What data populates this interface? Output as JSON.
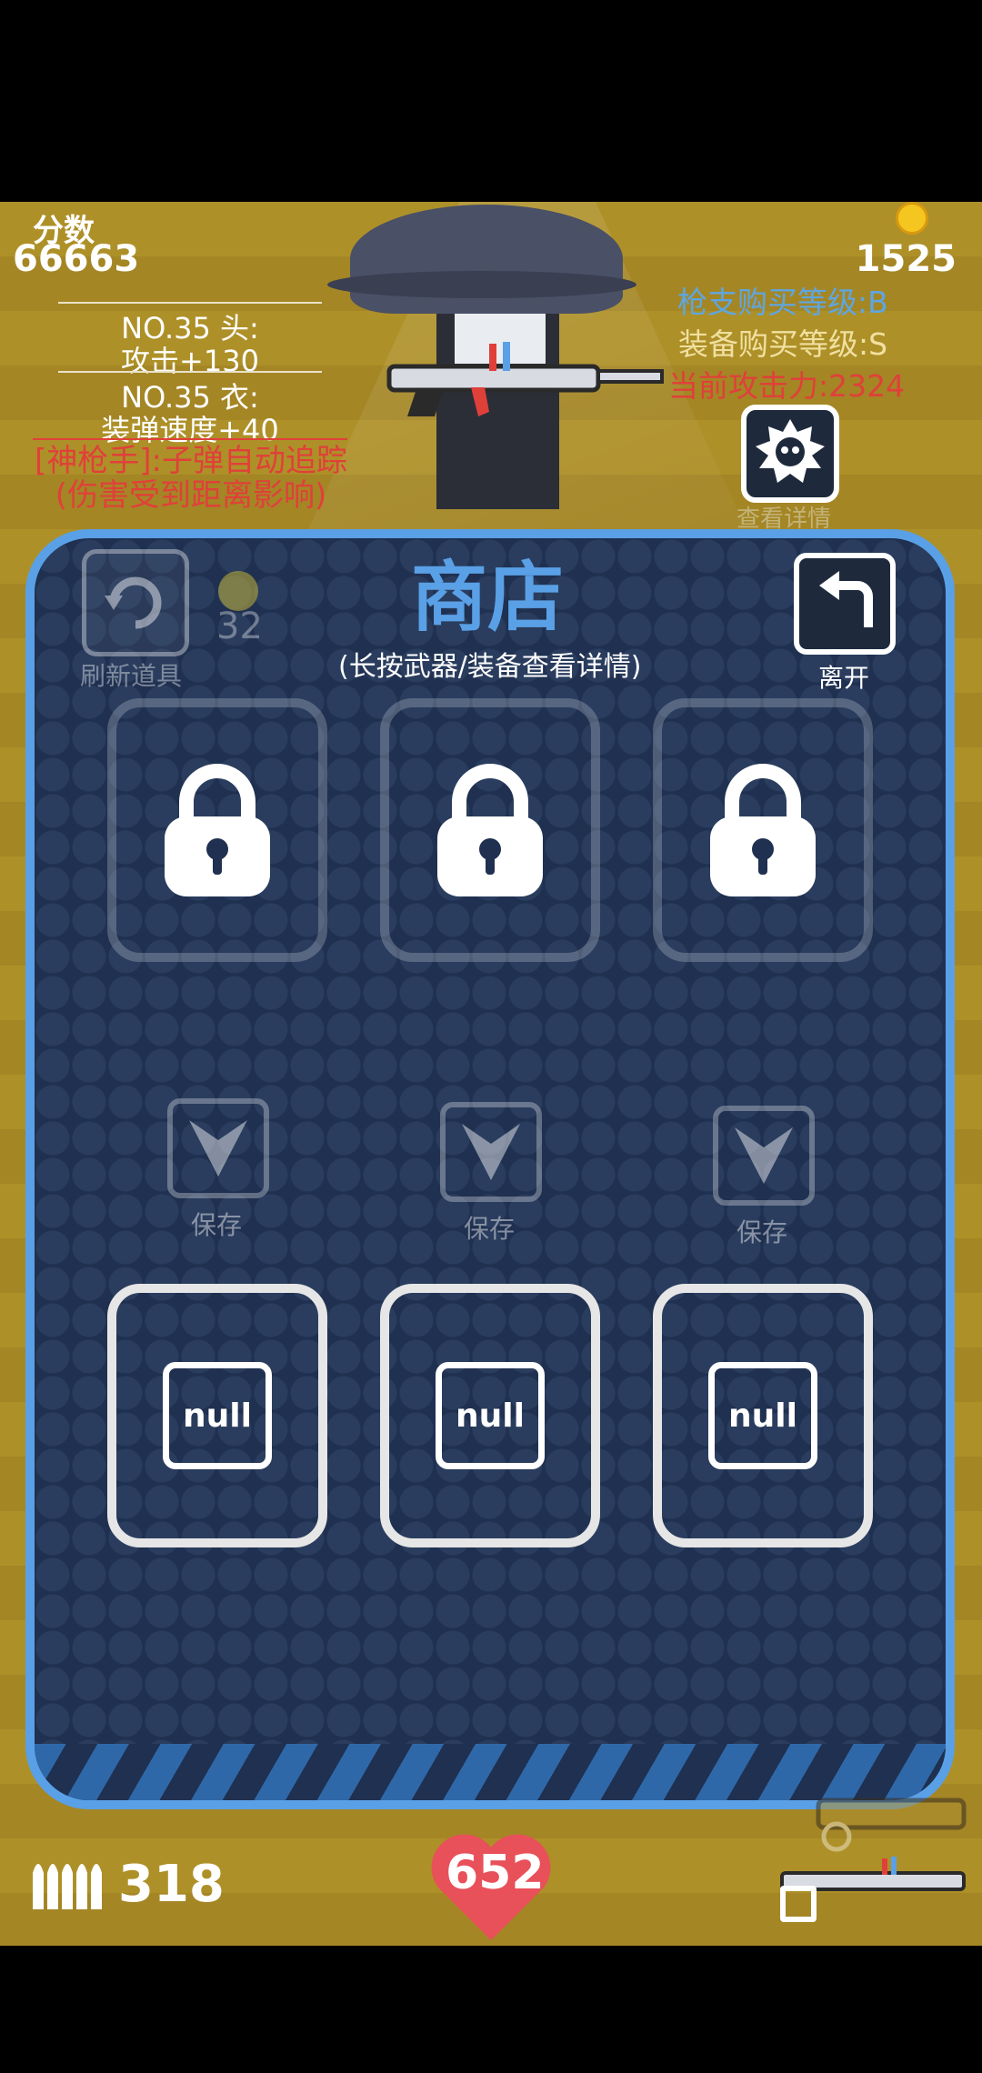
{
  "hud": {
    "score_label": "分数",
    "score_value": "66663",
    "coins": "1525",
    "gear_head_name": "NO.35 头:",
    "gear_head_effect": "攻击+130",
    "gear_body_name": "NO.35 衣:",
    "gear_body_effect": "装弹速度+40",
    "gun_level": "枪支购买等级:B",
    "equip_level": "装备购买等级:S",
    "attack_power": "当前攻击力:2324",
    "skill_line1": "[神枪手]:子弹自动追踪",
    "skill_line2": "(伤害受到距离影响)",
    "detail_label": "查看详情",
    "ammo": "318",
    "hp": "652"
  },
  "shop": {
    "title": "商店",
    "subtitle": "(长按武器/装备查看详情)",
    "refresh_label": "刷新道具",
    "refresh_cost": "32",
    "leave_label": "离开",
    "save_label": "保存",
    "null_label": "null"
  },
  "colors": {
    "background": "#a88b25",
    "panel": "#1f3050",
    "panel_border": "#5aa0e6",
    "gun_level": "#5fa6e0",
    "equip_level": "#f0e0a0",
    "attack": "#e0403a",
    "heart": "#e8505a"
  }
}
